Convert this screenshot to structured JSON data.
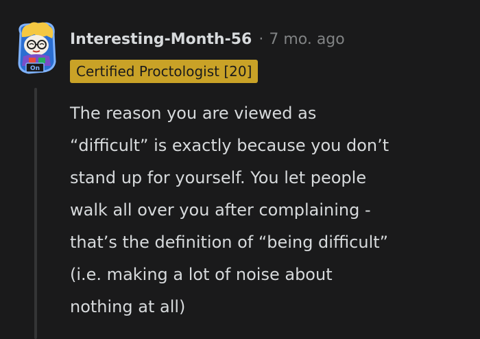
{
  "comment": {
    "author": "Interesting-Month-56",
    "separator": "·",
    "timestamp": "7 mo. ago",
    "flair": "Certified Proctologist [20]",
    "avatar_icon": "snoo-avatar-icon",
    "avatar_badge": "On",
    "lines": [
      "The reason you are viewed as",
      "“difficult” is exactly because you don’t",
      "stand up for yourself. You let people",
      "walk all over you after complaining -",
      "that’s the definition of “being difficult”",
      "(i.e. making a lot of noise about",
      "nothing at all)"
    ]
  },
  "colors": {
    "background": "#1a1a1b",
    "text": "#d7dadc",
    "meta": "#818384",
    "flair_bg": "#c9a227",
    "thread_line": "#343536"
  }
}
